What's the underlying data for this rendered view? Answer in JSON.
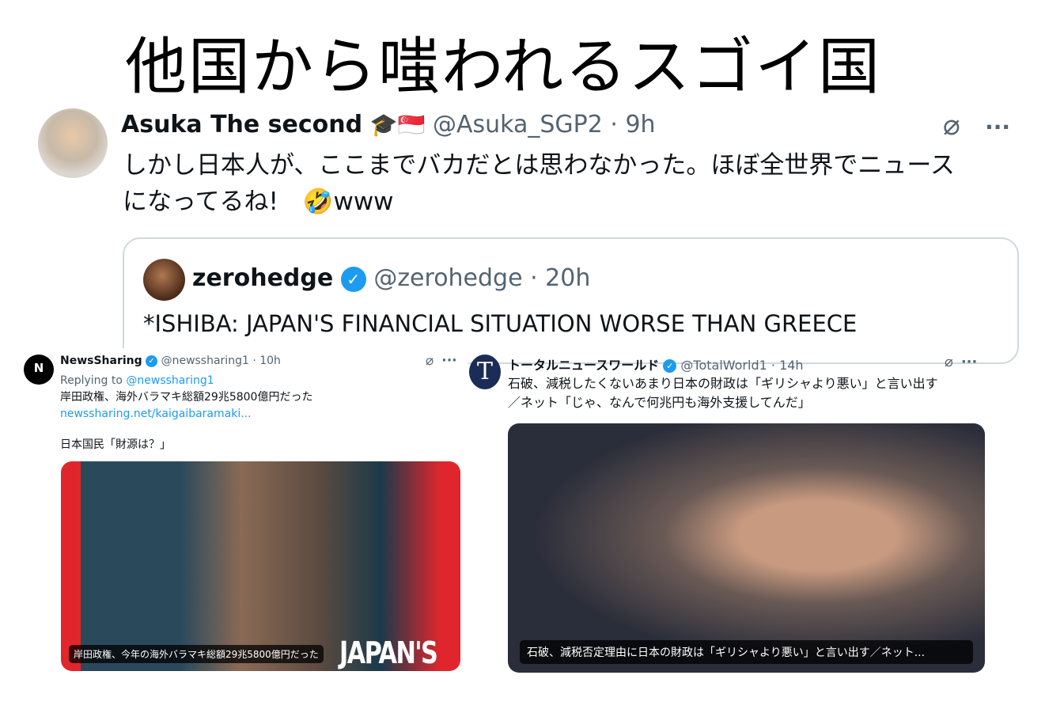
{
  "title": "他国から嗤われるスゴイ国",
  "main_tweet": {
    "name": "Asuka The second",
    "badges": "🎓🇸🇬",
    "handle": "@Asuka_SGP2",
    "time": "· 9h",
    "text_line1": "しかし日本人が、ここまでバカだとは思わなかった。ほぼ全世界でニュース",
    "text_line2": "になってるね!　🤣www",
    "icon_grok": "grok-icon",
    "icon_more": "more-icon"
  },
  "quote_tweet": {
    "name": "zerohedge",
    "handle": "@zerohedge",
    "time": "· 20h",
    "text": "*ISHIBA: JAPAN'S FINANCIAL SITUATION WORSE THAN GREECE"
  },
  "left_tweet": {
    "avatar_letter": "N",
    "name": "NewsSharing",
    "handle": "@newssharing1",
    "time": "· 10h",
    "replying_prefix": "Replying to ",
    "replying_handle": "@newssharing1",
    "text": "岸田政権、海外バラマキ総額29兆5800億円だった",
    "link": "newssharing.net/kaigaibaramaki...",
    "text2": "日本国民「財源は？」",
    "image_caption": "岸田政権、今年の海外バラマキ総額29兆5800億円だった",
    "image_overlay": "JAPAN'S"
  },
  "right_tweet": {
    "avatar_letter": "T",
    "name": "トータルニュースワールド",
    "handle": "@TotalWorld1",
    "time": "· 14h",
    "text_line1": "石破、減税したくないあまり日本の財政は「ギリシャより悪い」と言い出す",
    "text_line2": "／ネット「じゃ、なんで何兆円も海外支援してんだ」",
    "image_caption": "石破、減税否定理由に日本の財政は「ギリシャより悪い」と言い出す／ネット..."
  },
  "glyphs": {
    "grok": "⌀",
    "more": "···",
    "check": "✓"
  },
  "colors": {
    "accent": "#1d9bf0",
    "muted": "#536471",
    "red": "#e0262c"
  }
}
